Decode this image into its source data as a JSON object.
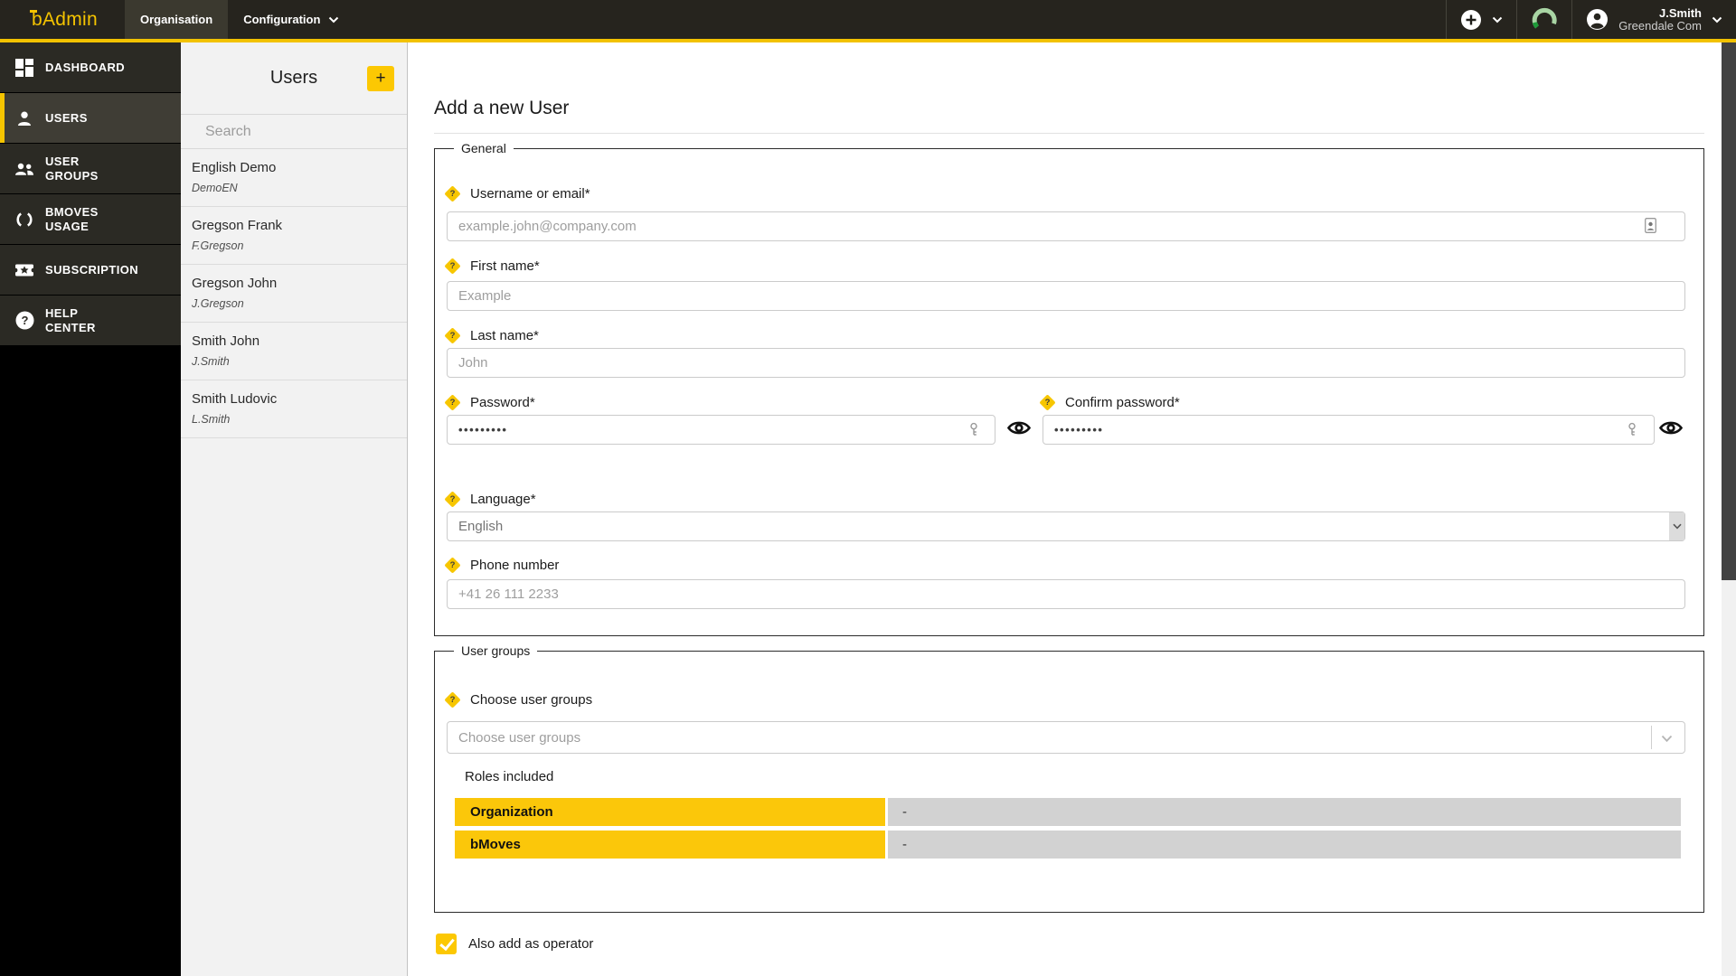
{
  "topbar": {
    "logo": "bAdmin",
    "menus": [
      {
        "label": "Organisation",
        "active": true
      },
      {
        "label": "Configuration",
        "active": false
      }
    ],
    "user": {
      "name": "J.Smith",
      "org": "Greendale Com"
    }
  },
  "sidebar": {
    "items": [
      {
        "label": "DASHBOARD",
        "icon": "dashboard-icon",
        "active": false
      },
      {
        "label": "USERS",
        "icon": "user-icon",
        "active": true
      },
      {
        "label": "USER\nGROUPS",
        "icon": "user-groups-icon",
        "active": false
      },
      {
        "label": "BMOVES\nUSAGE",
        "icon": "usage-circle-icon",
        "active": false
      },
      {
        "label": "SUBSCRIPTION",
        "icon": "ticket-icon",
        "active": false
      },
      {
        "label": "HELP\nCENTER",
        "icon": "help-icon",
        "active": false
      }
    ]
  },
  "users_panel": {
    "title": "Users",
    "add_button_label": "+",
    "search_placeholder": "Search",
    "users": [
      {
        "name": "English Demo",
        "username": "DemoEN"
      },
      {
        "name": "Gregson Frank",
        "username": "F.Gregson"
      },
      {
        "name": "Gregson John",
        "username": "J.Gregson"
      },
      {
        "name": "Smith John",
        "username": "J.Smith"
      },
      {
        "name": "Smith Ludovic",
        "username": "L.Smith"
      }
    ]
  },
  "form": {
    "title": "Add a new User",
    "general": {
      "legend": "General",
      "username": {
        "label": "Username or email*",
        "placeholder": "example.john@company.com"
      },
      "first_name": {
        "label": "First name*",
        "placeholder": "Example"
      },
      "last_name": {
        "label": "Last name*",
        "placeholder": "John"
      },
      "password": {
        "label": "Password*",
        "value": "•••••••••"
      },
      "confirm_password": {
        "label": "Confirm password*",
        "value": "•••••••••"
      },
      "language": {
        "label": "Language*",
        "value": "English"
      },
      "phone": {
        "label": "Phone number",
        "placeholder": "+41 26 111 2233"
      }
    },
    "user_groups": {
      "legend": "User groups",
      "choose": {
        "label": "Choose user groups",
        "placeholder": "Choose user groups"
      },
      "roles_title": "Roles included",
      "roles": [
        {
          "name": "Organization",
          "value": "-"
        },
        {
          "name": "bMoves",
          "value": "-"
        }
      ]
    },
    "operator": {
      "label": "Also add as operator",
      "checked": true
    }
  },
  "colors": {
    "accent_yellow": "#F5C400",
    "role_row_yellow": "#FBC70A",
    "role_row_gray": "#D2D2D2",
    "gauge_light_green": "#A9D5A4",
    "gauge_dark_green": "#1D9B38"
  }
}
